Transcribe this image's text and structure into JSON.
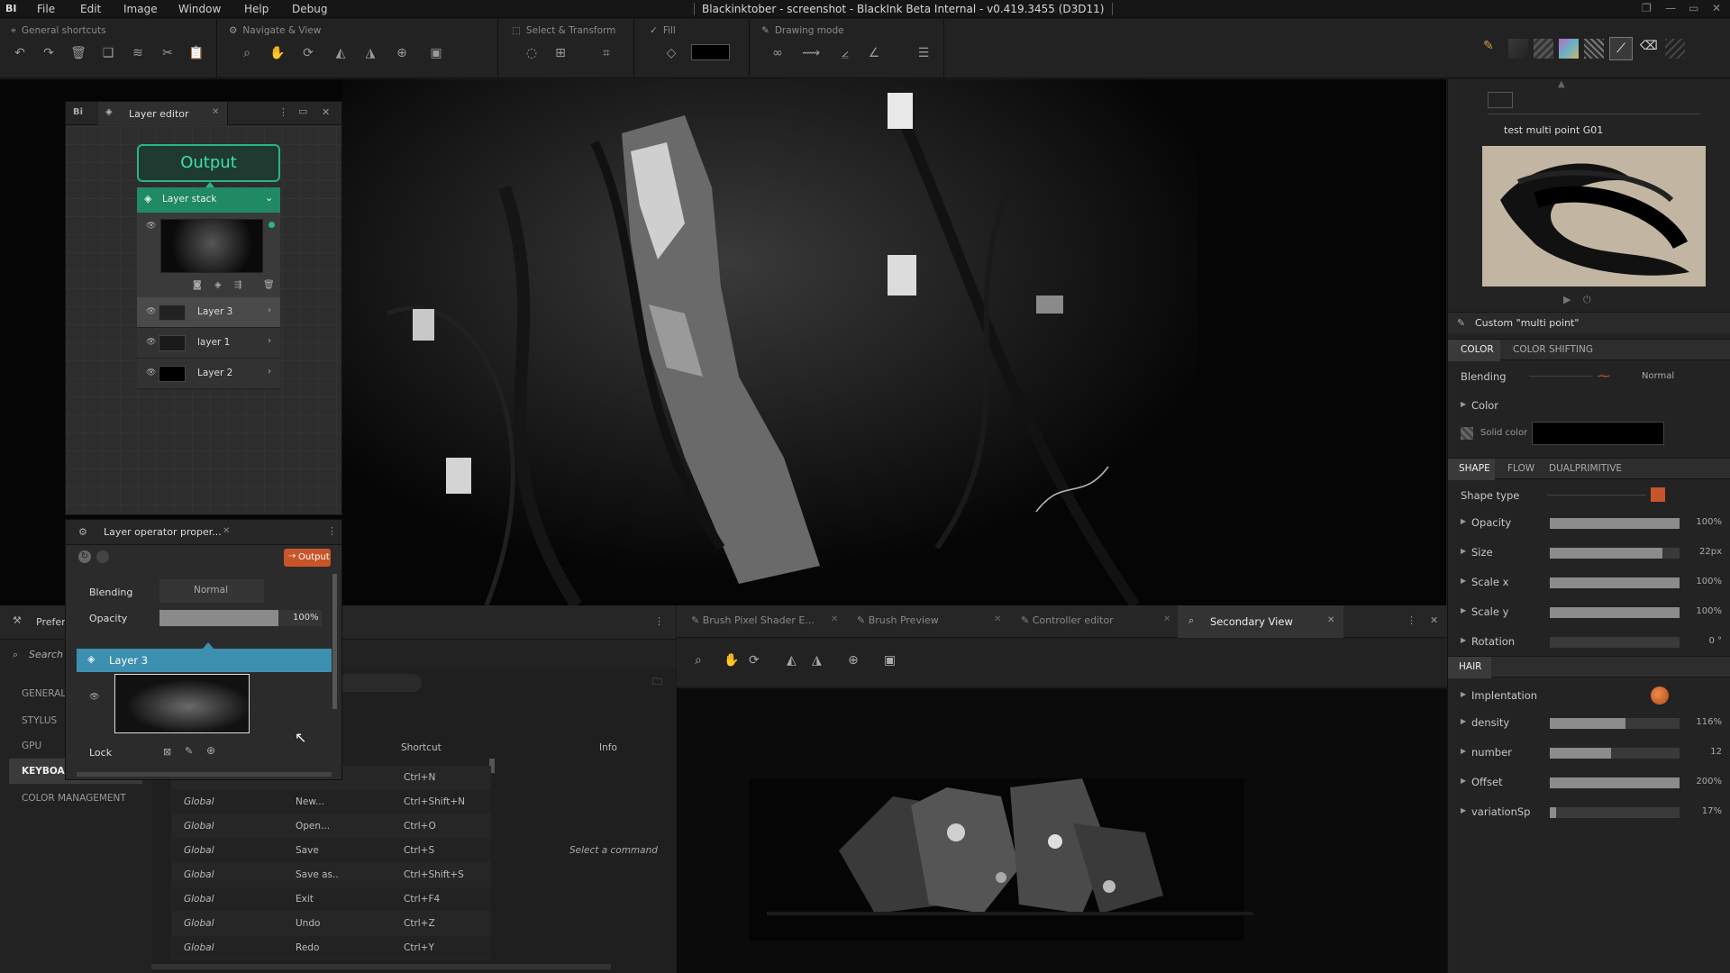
{
  "app": {
    "logo": "BI",
    "title": "Blackinktober - screenshot - BlackInk Beta Internal - v0.419.3455 (D3D11)"
  },
  "menu": [
    "File",
    "Edit",
    "Image",
    "Window",
    "Help",
    "Debug"
  ],
  "toolbar": {
    "groups": [
      {
        "label": "General shortcuts"
      },
      {
        "label": "Navigate & View"
      },
      {
        "label": "Select & Transform"
      },
      {
        "label": "Fill"
      },
      {
        "label": "Drawing mode"
      }
    ],
    "fill_color": "#000000"
  },
  "layer_editor": {
    "title": "Layer editor",
    "output_label": "Output",
    "stack_label": "Layer stack",
    "layers": [
      {
        "name": "Layer 3"
      },
      {
        "name": "layer 1"
      },
      {
        "name": "Layer 2"
      }
    ]
  },
  "layer_operator": {
    "title": "Layer operator proper...",
    "output_btn": "Output",
    "blending_label": "Blending",
    "blending_value": "Normal",
    "opacity_label": "Opacity",
    "opacity_value": "100%",
    "opacity_fraction": 1.0,
    "layer_name": "Layer 3",
    "lock_label": "Lock"
  },
  "preferences": {
    "title": "Prefer",
    "search": "Search",
    "side": [
      "GENERAL",
      "STYLUS",
      "GPU",
      "KEYBOAR",
      "COLOR MANAGEMENT"
    ],
    "columns": {
      "shortcut": "Shortcut",
      "info": "Info"
    },
    "info_hint": "Select a command",
    "rows": [
      {
        "scope": "",
        "cmd": "",
        "key": "Ctrl+N"
      },
      {
        "scope": "Global",
        "cmd": "New...",
        "key": "Ctrl+Shift+N"
      },
      {
        "scope": "Global",
        "cmd": "Open...",
        "key": "Ctrl+O"
      },
      {
        "scope": "Global",
        "cmd": "Save",
        "key": "Ctrl+S"
      },
      {
        "scope": "Global",
        "cmd": "Save as..",
        "key": "Ctrl+Shift+S"
      },
      {
        "scope": "Global",
        "cmd": "Exit",
        "key": "Ctrl+F4"
      },
      {
        "scope": "Global",
        "cmd": "Undo",
        "key": "Ctrl+Z"
      },
      {
        "scope": "Global",
        "cmd": "Redo",
        "key": "Ctrl+Y"
      }
    ]
  },
  "bottom_tabs": [
    "Brush Pixel Shader E...",
    "Brush Preview",
    "Controller editor",
    "Secondary View"
  ],
  "brush": {
    "name": "test multi point G01",
    "custom": "Custom \"multi point\"",
    "color_tabs": [
      "COLOR",
      "COLOR SHIFTING"
    ],
    "blending_label": "Blending",
    "blending_value": "Normal",
    "color_label": "Color",
    "solid_label": "Solid color",
    "solid_value": "#000000",
    "shape_tabs": [
      "SHAPE",
      "FLOW",
      "DUALPRIMITIVE"
    ],
    "shape_type": "Shape type",
    "accent": "#c8552a",
    "shape_params": [
      {
        "label": "Opacity",
        "value": "100%",
        "fraction": 1.0
      },
      {
        "label": "Size",
        "value": "22px",
        "fraction": 0.87
      },
      {
        "label": "Scale x",
        "value": "100%",
        "fraction": 1.0
      },
      {
        "label": "Scale y",
        "value": "100%",
        "fraction": 1.0
      },
      {
        "label": "Rotation",
        "value": "0 °",
        "fraction": 0.0
      }
    ],
    "hair_tab": "HAIR",
    "implementation": "Implentation",
    "hair_params": [
      {
        "label": "density",
        "value": "116%",
        "fraction": 0.58
      },
      {
        "label": "number",
        "value": "12",
        "fraction": 0.47
      },
      {
        "label": "Offset",
        "value": "200%",
        "fraction": 1.0
      },
      {
        "label": "variationSp",
        "value": "17%",
        "fraction": 0.05
      }
    ]
  }
}
